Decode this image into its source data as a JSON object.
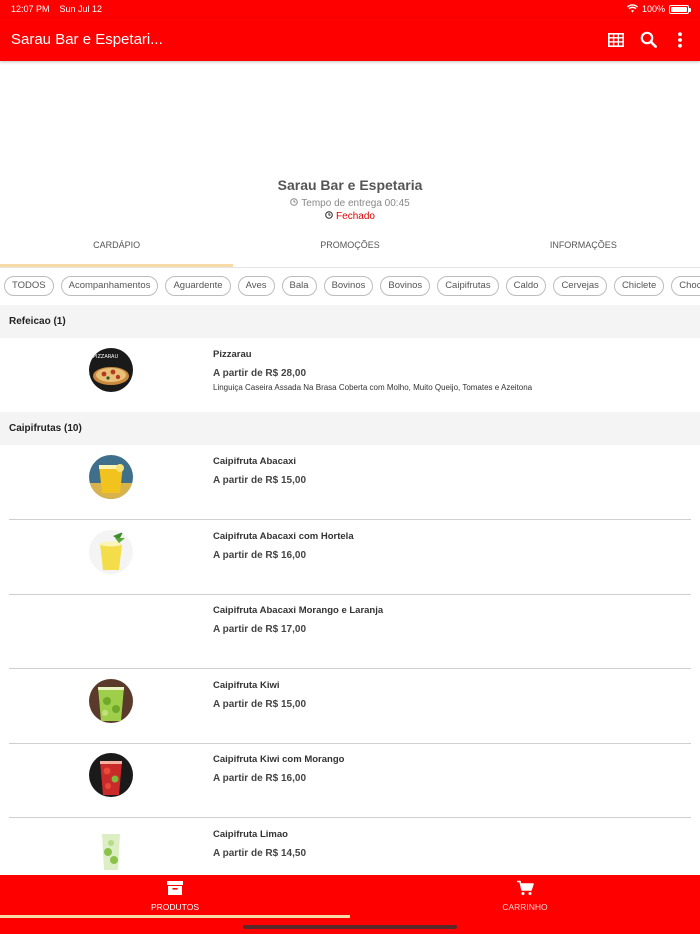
{
  "status_bar": {
    "time": "12:07 PM",
    "date": "Sun Jul 12",
    "battery": "100%",
    "battery_level": 1.0
  },
  "app_bar": {
    "title": "Sarau Bar e Espetari...",
    "icons": [
      "table-icon",
      "search-icon",
      "more-vert-icon"
    ]
  },
  "store": {
    "name": "Sarau Bar e Espetaria",
    "delivery": "Tempo de entrega 00:45",
    "status": "Fechado"
  },
  "tabs": [
    {
      "label": "CARDÁPIO",
      "active": true
    },
    {
      "label": "PROMOÇÕES",
      "active": false
    },
    {
      "label": "INFORMAÇÕES",
      "active": false
    }
  ],
  "categories": [
    "TODOS",
    "Acompanhamentos",
    "Aguardente",
    "Aves",
    "Bala",
    "Bovinos",
    "Bovinos",
    "Caipifrutas",
    "Caldo",
    "Cervejas",
    "Chiclete",
    "Chocolat"
  ],
  "sections": [
    {
      "title": "Refeicao (1)",
      "products": [
        {
          "name": "Pizzarau",
          "price": "A partir de R$ 28,00",
          "description": "Linguiça Caseira Assada Na Brasa Coberta com Molho, Muito Queijo, Tomates e Azeitona",
          "thumb": "pizza"
        }
      ]
    },
    {
      "title": "Caipifrutas (10)",
      "products": [
        {
          "name": "Caipifruta Abacaxi",
          "price": "A partir de R$ 15,00",
          "description": "",
          "thumb": "yellow-drink"
        },
        {
          "name": "Caipifruta Abacaxi com Hortela",
          "price": "A partir de R$ 16,00",
          "description": "",
          "thumb": "yellow-mint-drink"
        },
        {
          "name": "Caipifruta Abacaxi Morango e Laranja",
          "price": "A partir de R$ 17,00",
          "description": "",
          "thumb": ""
        },
        {
          "name": "Caipifruta Kiwi",
          "price": "A partir de R$ 15,00",
          "description": "",
          "thumb": "green-drink"
        },
        {
          "name": "Caipifruta Kiwi com Morango",
          "price": "A partir de R$ 16,00",
          "description": "",
          "thumb": "red-drink"
        },
        {
          "name": "Caipifruta Limao",
          "price": "A partir de R$ 14,50",
          "description": "",
          "thumb": "lime-drink"
        }
      ]
    }
  ],
  "bottom_nav": [
    {
      "label": "PRODUTOS",
      "active": true,
      "icon": "box-icon"
    },
    {
      "label": "CARRINHO",
      "active": false,
      "icon": "cart-icon"
    }
  ],
  "colors": {
    "primary": "#ff0000",
    "accent_underline": "#f8d9a8",
    "closed": "#e00000"
  }
}
